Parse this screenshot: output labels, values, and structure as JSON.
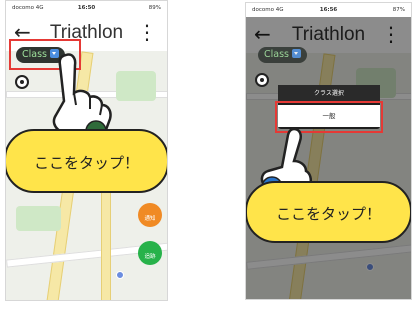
{
  "left_screen": {
    "status": {
      "carrier": "docomo 4G",
      "time": "16:50",
      "right": "89%"
    },
    "header": {
      "back_icon": "back-arrow-icon",
      "title": "Triathlon",
      "menu_icon": "more-vertical-icon"
    },
    "class_button": {
      "label": "Class",
      "icon": "chevron-down-icon"
    },
    "callout": "ここをタップ！",
    "fab_notify": "通知",
    "fab_track": "追跡"
  },
  "right_screen": {
    "status": {
      "carrier": "docomo 4G",
      "time": "16:56",
      "right": "87%"
    },
    "header": {
      "back_icon": "back-arrow-icon",
      "title": "Triathlon",
      "menu_icon": "more-vertical-icon"
    },
    "class_button": {
      "label": "Class",
      "icon": "chevron-down-icon"
    },
    "dialog": {
      "title": "クラス選択",
      "option": "一般"
    },
    "callout": "ここをタップ！"
  },
  "colors": {
    "highlight": "#e53935",
    "callout_bg": "#ffe44a",
    "class_button_bg": "#2e3430"
  }
}
